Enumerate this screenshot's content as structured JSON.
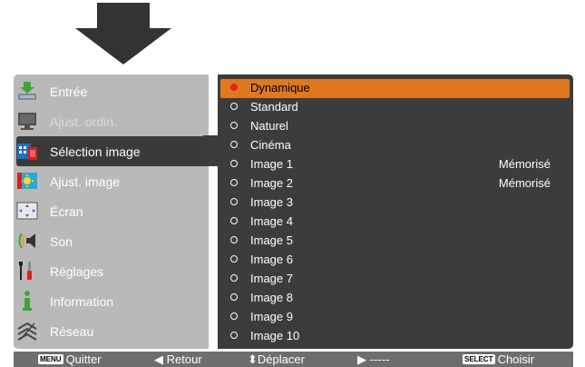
{
  "menu": {
    "items": [
      {
        "label": "Entrée",
        "icon": "input-arrow-icon",
        "disabled": false
      },
      {
        "label": "Ajust. ordin.",
        "icon": "computer-monitor-icon",
        "disabled": true
      },
      {
        "label": "Sélection image",
        "icon": "image-select-icon",
        "disabled": false,
        "selected": true
      },
      {
        "label": "Ajust. image",
        "icon": "image-adjust-icon",
        "disabled": false
      },
      {
        "label": "Écran",
        "icon": "screen-icon",
        "disabled": false
      },
      {
        "label": "Son",
        "icon": "speaker-icon",
        "disabled": false
      },
      {
        "label": "Réglages",
        "icon": "settings-tools-icon",
        "disabled": false
      },
      {
        "label": "Information",
        "icon": "info-icon",
        "disabled": false
      },
      {
        "label": "Réseau",
        "icon": "network-icon",
        "disabled": false
      }
    ]
  },
  "options": {
    "items": [
      {
        "label": "Dynamique",
        "status": "",
        "selected": true
      },
      {
        "label": "Standard",
        "status": ""
      },
      {
        "label": "Naturel",
        "status": ""
      },
      {
        "label": "Cinéma",
        "status": ""
      },
      {
        "label": "Image 1",
        "status": "Mémorisé"
      },
      {
        "label": "Image 2",
        "status": "Mémorisé"
      },
      {
        "label": "Image 3",
        "status": ""
      },
      {
        "label": "Image 4",
        "status": ""
      },
      {
        "label": "Image 5",
        "status": ""
      },
      {
        "label": "Image 6",
        "status": ""
      },
      {
        "label": "Image 7",
        "status": ""
      },
      {
        "label": "Image 8",
        "status": ""
      },
      {
        "label": "Image 9",
        "status": ""
      },
      {
        "label": "Image 10",
        "status": ""
      }
    ]
  },
  "status_bar": {
    "menu_key": "MENU",
    "quit": "Quitter",
    "back": "Retour",
    "move": "Déplacer",
    "next": "-----",
    "select_key": "SELECT",
    "choose": "Choisir"
  },
  "colors": {
    "accent": "#e07820",
    "selected_marker": "#e8201e",
    "left_panel": "#b9b9b9",
    "right_panel": "#3c3c3c",
    "status_bar": "#6e6e6e"
  }
}
